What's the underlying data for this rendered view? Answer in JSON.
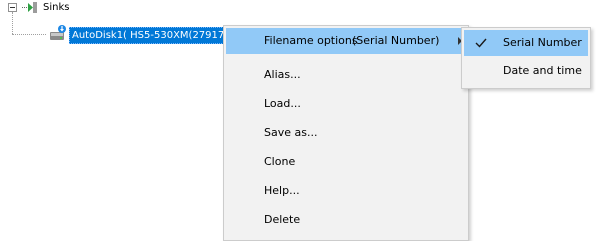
{
  "tree": {
    "root_label": "Sinks",
    "child_label": "AutoDisk1( HS5-530XM(27917) )"
  },
  "context_menu": {
    "items": [
      {
        "label": "Filename options",
        "extra": "(Serial Number)",
        "has_submenu": true,
        "highlighted": true
      },
      {
        "label": "Alias..."
      },
      {
        "label": "Load..."
      },
      {
        "label": "Save as..."
      },
      {
        "label": "Clone"
      },
      {
        "label": "Help..."
      },
      {
        "label": "Delete"
      }
    ]
  },
  "submenu": {
    "items": [
      {
        "label": "Serial Number",
        "checked": true,
        "highlighted": true
      },
      {
        "label": "Date and time",
        "checked": false
      }
    ]
  },
  "colors": {
    "selection": "#0078d7",
    "menu_highlight": "#91c9f7",
    "menu_background": "#f2f2f2"
  }
}
